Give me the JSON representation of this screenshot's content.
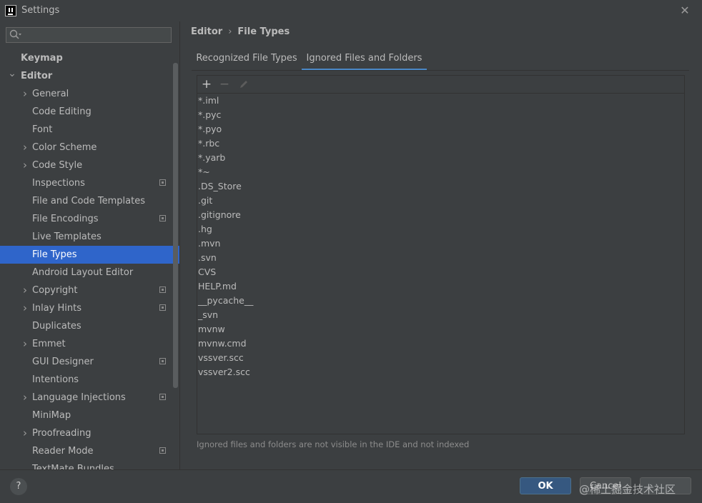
{
  "window": {
    "title": "Settings"
  },
  "search": {
    "value": "",
    "placeholder": ""
  },
  "tree": {
    "items": [
      {
        "label": "Keymap",
        "level": 0,
        "arrow": "",
        "project": false
      },
      {
        "label": "Editor",
        "level": 0,
        "arrow": "down",
        "project": false
      },
      {
        "label": "General",
        "level": 1,
        "arrow": "right",
        "project": false
      },
      {
        "label": "Code Editing",
        "level": 1,
        "arrow": "",
        "project": false
      },
      {
        "label": "Font",
        "level": 1,
        "arrow": "",
        "project": false
      },
      {
        "label": "Color Scheme",
        "level": 1,
        "arrow": "right",
        "project": false
      },
      {
        "label": "Code Style",
        "level": 1,
        "arrow": "right",
        "project": false
      },
      {
        "label": "Inspections",
        "level": 1,
        "arrow": "",
        "project": true
      },
      {
        "label": "File and Code Templates",
        "level": 1,
        "arrow": "",
        "project": false
      },
      {
        "label": "File Encodings",
        "level": 1,
        "arrow": "",
        "project": true
      },
      {
        "label": "Live Templates",
        "level": 1,
        "arrow": "",
        "project": false
      },
      {
        "label": "File Types",
        "level": 1,
        "arrow": "",
        "project": false,
        "selected": true
      },
      {
        "label": "Android Layout Editor",
        "level": 1,
        "arrow": "",
        "project": false
      },
      {
        "label": "Copyright",
        "level": 1,
        "arrow": "right",
        "project": true
      },
      {
        "label": "Inlay Hints",
        "level": 1,
        "arrow": "right",
        "project": true
      },
      {
        "label": "Duplicates",
        "level": 1,
        "arrow": "",
        "project": false
      },
      {
        "label": "Emmet",
        "level": 1,
        "arrow": "right",
        "project": false
      },
      {
        "label": "GUI Designer",
        "level": 1,
        "arrow": "",
        "project": true
      },
      {
        "label": "Intentions",
        "level": 1,
        "arrow": "",
        "project": false
      },
      {
        "label": "Language Injections",
        "level": 1,
        "arrow": "right",
        "project": true
      },
      {
        "label": "MiniMap",
        "level": 1,
        "arrow": "",
        "project": false
      },
      {
        "label": "Proofreading",
        "level": 1,
        "arrow": "right",
        "project": false
      },
      {
        "label": "Reader Mode",
        "level": 1,
        "arrow": "",
        "project": true
      },
      {
        "label": "TextMate Bundles",
        "level": 1,
        "arrow": "",
        "project": false
      }
    ]
  },
  "breadcrumb": {
    "parent": "Editor",
    "separator": "›",
    "current": "File Types"
  },
  "tabs": {
    "recognized": "Recognized File Types",
    "ignored": "Ignored Files and Folders"
  },
  "toolbar": {
    "add": "+",
    "remove": "−"
  },
  "ignored_items": [
    "*.iml",
    "*.pyc",
    "*.pyo",
    "*.rbc",
    "*.yarb",
    "*~",
    ".DS_Store",
    ".git",
    ".gitignore",
    ".hg",
    ".mvn",
    ".svn",
    "CVS",
    "HELP.md",
    "__pycache__",
    "_svn",
    "mvnw",
    "mvnw.cmd",
    "vssver.scc",
    "vssver2.scc"
  ],
  "hint": "Ignored files and folders are not visible in the IDE and not indexed",
  "footer": {
    "help": "?",
    "ok": "OK",
    "cancel": "Cancel",
    "apply": "",
    "watermark": "@稀土掘金技术社区"
  },
  "colors": {
    "selection": "#2f65ca",
    "accent": "#4a88c7",
    "ok_button": "#365880"
  }
}
